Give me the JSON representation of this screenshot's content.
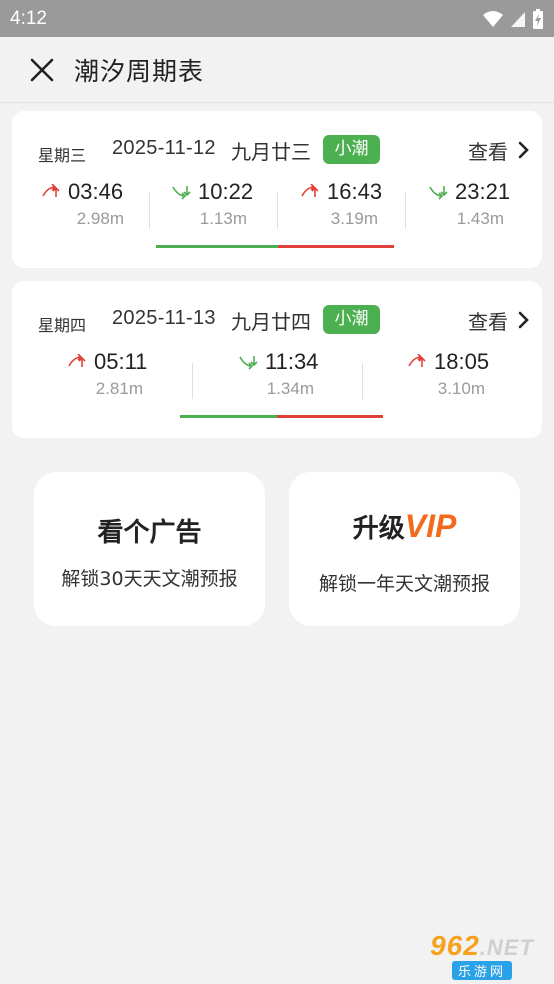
{
  "status": {
    "time": "4:12"
  },
  "header": {
    "title": "潮汐周期表"
  },
  "days": [
    {
      "weekday": "星期三",
      "date": "2025-11-12",
      "lunar": "九月廿三",
      "badge": "小潮",
      "view_label": "查看",
      "tides": [
        {
          "type": "high",
          "time": "03:46",
          "height": "2.98m"
        },
        {
          "type": "low",
          "time": "10:22",
          "height": "1.13m"
        },
        {
          "type": "high",
          "time": "16:43",
          "height": "3.19m"
        },
        {
          "type": "low",
          "time": "23:21",
          "height": "1.43m"
        }
      ]
    },
    {
      "weekday": "星期四",
      "date": "2025-11-13",
      "lunar": "九月廿四",
      "badge": "小潮",
      "view_label": "查看",
      "tides": [
        {
          "type": "high",
          "time": "05:11",
          "height": "2.81m"
        },
        {
          "type": "low",
          "time": "11:34",
          "height": "1.34m"
        },
        {
          "type": "high",
          "time": "18:05",
          "height": "3.10m"
        }
      ]
    }
  ],
  "promos": {
    "ad": {
      "title": "看个广告",
      "subtitle": "解锁30天天文潮预报"
    },
    "vip": {
      "title_prefix": "升级",
      "title_vip": "VIP",
      "subtitle": "解锁一年天文潮预报"
    }
  },
  "watermark": {
    "top": "962",
    "net": ".NET",
    "bottom": "乐游网"
  },
  "colors": {
    "high_tide": "#e0403a",
    "low_tide": "#4caf50",
    "badge": "#4caf50",
    "vip": "#f26a1b"
  }
}
